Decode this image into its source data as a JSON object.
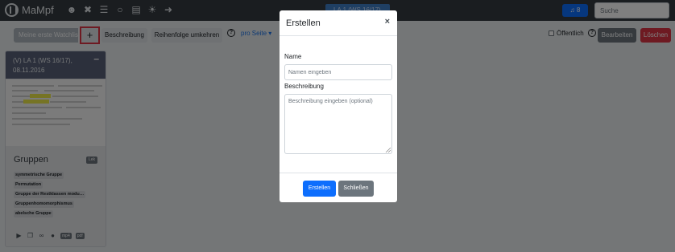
{
  "navbar": {
    "brand": "MaMpf",
    "icons": [
      "user-cog-icon",
      "tools-icon",
      "list-icon",
      "comments-icon",
      "id-card-icon",
      "satellite-dish-icon",
      "sign-out-icon"
    ],
    "lecture_button": "LA 1 (WS 16/17)",
    "notification_count": "8",
    "search_placeholder": "Suche"
  },
  "toolbar": {
    "watchlist_name": "Meine erste Watchlist",
    "add_label": "+",
    "description_button": "Beschreibung",
    "reverse_button": "Reihenfolge umkehren",
    "help_icon": "?",
    "per_page": "pro Seite",
    "public_label": "Öffentlich",
    "edit_button": "Bearbeiten",
    "delete_button": "Löschen"
  },
  "card": {
    "title": "(V) LA 1 (WS 16/17), 08.11.2016",
    "collapse": "–",
    "section_title": "Gruppen",
    "count_badge": "Lek",
    "tags": [
      "symmetrische Gruppe",
      "Permutation",
      "Gruppe der Restklassen modu…",
      "Gruppenhomomorphismus",
      "abelsche Gruppe"
    ],
    "formats": [
      "mp4",
      "pdf"
    ]
  },
  "modal": {
    "title": "Erstellen",
    "close": "×",
    "name_label": "Name",
    "name_placeholder": "Namen eingeben",
    "description_label": "Beschreibung",
    "description_placeholder": "Beschreibung eingeben (optional)",
    "create_button": "Erstellen",
    "close_button": "Schließen"
  },
  "colors": {
    "navbar": "#343a40",
    "primary": "#0d6efd",
    "danger": "#dc3545",
    "secondary": "#6c757d",
    "card_header": "#586179"
  }
}
